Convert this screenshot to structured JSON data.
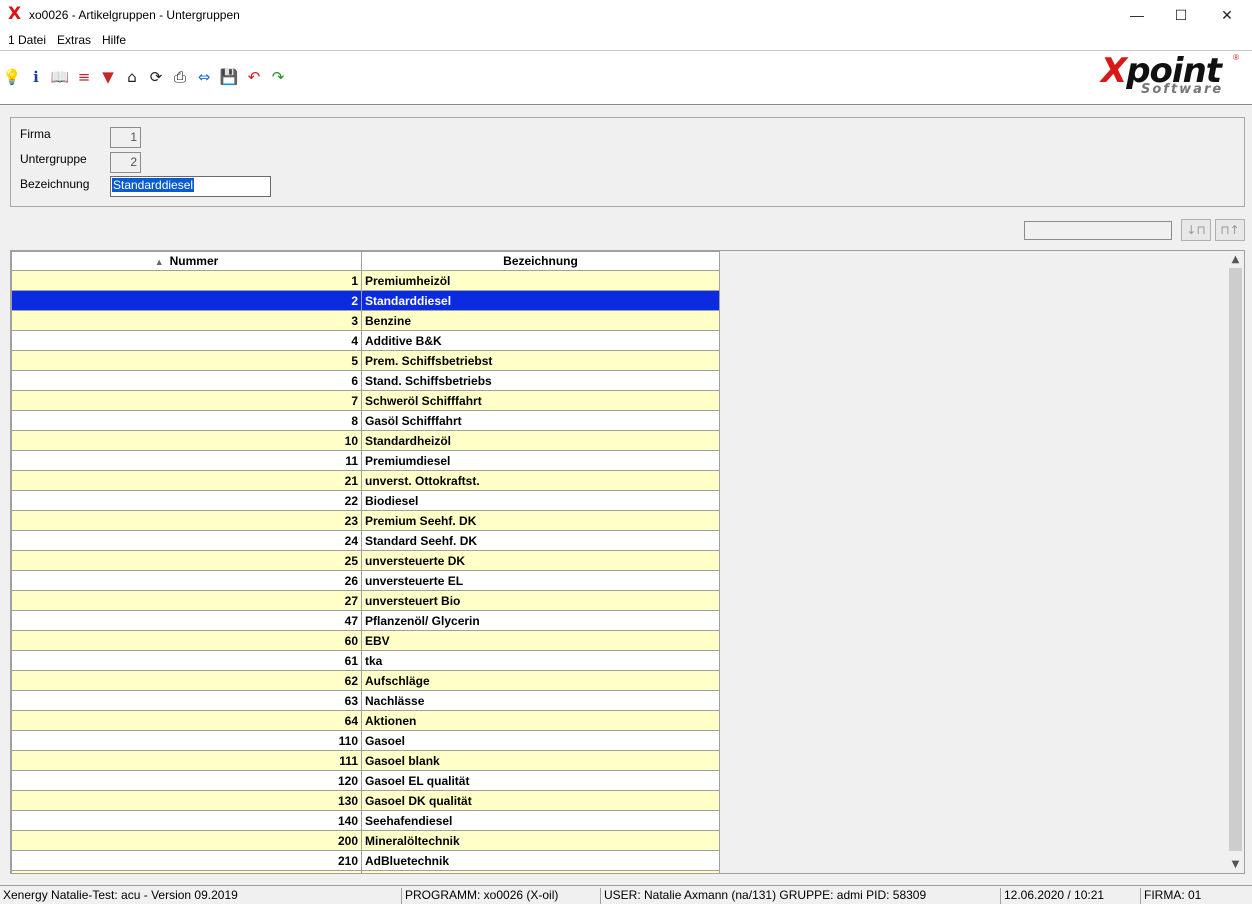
{
  "window": {
    "title": "xo0026 - Artikelgruppen - Untergruppen",
    "app_icon": "X",
    "minimize": "—",
    "maximize": "☐",
    "close": "✕"
  },
  "menu": [
    {
      "label": "1 Datei"
    },
    {
      "label": "Extras"
    },
    {
      "label": "Hilfe"
    }
  ],
  "toolbar": {
    "icons": [
      {
        "name": "lightbulb-icon",
        "glyph": "💡",
        "color": "#b08a00"
      },
      {
        "name": "info-icon",
        "glyph": "ℹ",
        "color": "#1a3f9a"
      },
      {
        "name": "book-icon",
        "glyph": "📖",
        "color": "#1a3f9a"
      },
      {
        "name": "database-icon",
        "glyph": "≡",
        "color": "#c0282a"
      },
      {
        "name": "filter-icon",
        "glyph": "▼",
        "color": "#c0282a"
      },
      {
        "name": "home-icon",
        "glyph": "⌂",
        "color": "#222222"
      },
      {
        "name": "refresh-icon",
        "glyph": "⟳",
        "color": "#222222"
      },
      {
        "name": "print-icon",
        "glyph": "⎙",
        "color": "#222222"
      },
      {
        "name": "teamviewer-icon",
        "glyph": "⇔",
        "color": "#1a6fd0"
      },
      {
        "name": "save-icon",
        "glyph": "💾",
        "color": "#1a6fd0"
      },
      {
        "name": "undo-icon",
        "glyph": "↶",
        "color": "#d02020"
      },
      {
        "name": "redo-icon",
        "glyph": "↷",
        "color": "#209020"
      }
    ]
  },
  "logo": {
    "main_x": "X",
    "main_rest": "point",
    "sub": "Software",
    "reg": "®"
  },
  "form": {
    "firma_label": "Firma",
    "firma_value": "1",
    "untergruppe_label": "Untergruppe",
    "untergruppe_value": "2",
    "bezeichnung_label": "Bezeichnung",
    "bezeichnung_value": "Standarddiesel"
  },
  "search": {
    "value": "",
    "search_down_glyph": "↓⊓",
    "search_up_glyph": "⊓↑"
  },
  "table": {
    "sort_arrow": "▲",
    "columns": [
      "Nummer",
      "Bezeichnung"
    ],
    "rows": [
      {
        "nummer": "1",
        "bezeichnung": "Premiumheizöl",
        "style": "yellow"
      },
      {
        "nummer": "2",
        "bezeichnung": "Standarddiesel",
        "style": "selected"
      },
      {
        "nummer": "3",
        "bezeichnung": "Benzine",
        "style": "yellow"
      },
      {
        "nummer": "4",
        "bezeichnung": "Additive B&K",
        "style": "white"
      },
      {
        "nummer": "5",
        "bezeichnung": "Prem. Schiffsbetriebst",
        "style": "yellow"
      },
      {
        "nummer": "6",
        "bezeichnung": "Stand. Schiffsbetriebs",
        "style": "white"
      },
      {
        "nummer": "7",
        "bezeichnung": "Schweröl Schifffahrt",
        "style": "yellow"
      },
      {
        "nummer": "8",
        "bezeichnung": "Gasöl Schifffahrt",
        "style": "white"
      },
      {
        "nummer": "10",
        "bezeichnung": "Standardheizöl",
        "style": "yellow"
      },
      {
        "nummer": "11",
        "bezeichnung": "Premiumdiesel",
        "style": "white"
      },
      {
        "nummer": "21",
        "bezeichnung": "unverst. Ottokraftst.",
        "style": "yellow"
      },
      {
        "nummer": "22",
        "bezeichnung": "Biodiesel",
        "style": "white"
      },
      {
        "nummer": "23",
        "bezeichnung": "Premium Seehf. DK",
        "style": "yellow"
      },
      {
        "nummer": "24",
        "bezeichnung": "Standard Seehf. DK",
        "style": "white"
      },
      {
        "nummer": "25",
        "bezeichnung": "unversteuerte DK",
        "style": "yellow"
      },
      {
        "nummer": "26",
        "bezeichnung": "unversteuerte EL",
        "style": "white"
      },
      {
        "nummer": "27",
        "bezeichnung": "unversteuert Bio",
        "style": "yellow"
      },
      {
        "nummer": "47",
        "bezeichnung": "Pflanzenöl/ Glycerin",
        "style": "white"
      },
      {
        "nummer": "60",
        "bezeichnung": "EBV",
        "style": "yellow"
      },
      {
        "nummer": "61",
        "bezeichnung": "tka",
        "style": "white"
      },
      {
        "nummer": "62",
        "bezeichnung": "Aufschläge",
        "style": "yellow"
      },
      {
        "nummer": "63",
        "bezeichnung": "Nachlässe",
        "style": "white"
      },
      {
        "nummer": "64",
        "bezeichnung": "Aktionen",
        "style": "yellow"
      },
      {
        "nummer": "110",
        "bezeichnung": "Gasoel",
        "style": "white"
      },
      {
        "nummer": "111",
        "bezeichnung": "Gasoel blank",
        "style": "yellow"
      },
      {
        "nummer": "120",
        "bezeichnung": "Gasoel EL qualität",
        "style": "white"
      },
      {
        "nummer": "130",
        "bezeichnung": "Gasoel DK qualität",
        "style": "yellow"
      },
      {
        "nummer": "140",
        "bezeichnung": "Seehafendiesel",
        "style": "white"
      },
      {
        "nummer": "200",
        "bezeichnung": "Mineralöltechnik",
        "style": "yellow"
      },
      {
        "nummer": "210",
        "bezeichnung": "AdBluetechnik",
        "style": "white"
      },
      {
        "nummer": "",
        "bezeichnung": "",
        "style": "yellow"
      }
    ]
  },
  "scrollbar": {
    "up": "▲",
    "down": "▼"
  },
  "status": {
    "system": "Xenergy Natalie-Test: acu - Version 09.2019",
    "program": "PROGRAMM: xo0026 (X-oil)",
    "user": "USER: Natalie Axmann (na/131)  GRUPPE: admi  PID: 58309",
    "datetime": "12.06.2020 / 10:21",
    "firma": "FIRMA: 01"
  },
  "colors": {
    "row_yellow": "#ffffc8",
    "row_selected": "#0a2be0",
    "brand_red": "#d81818"
  }
}
